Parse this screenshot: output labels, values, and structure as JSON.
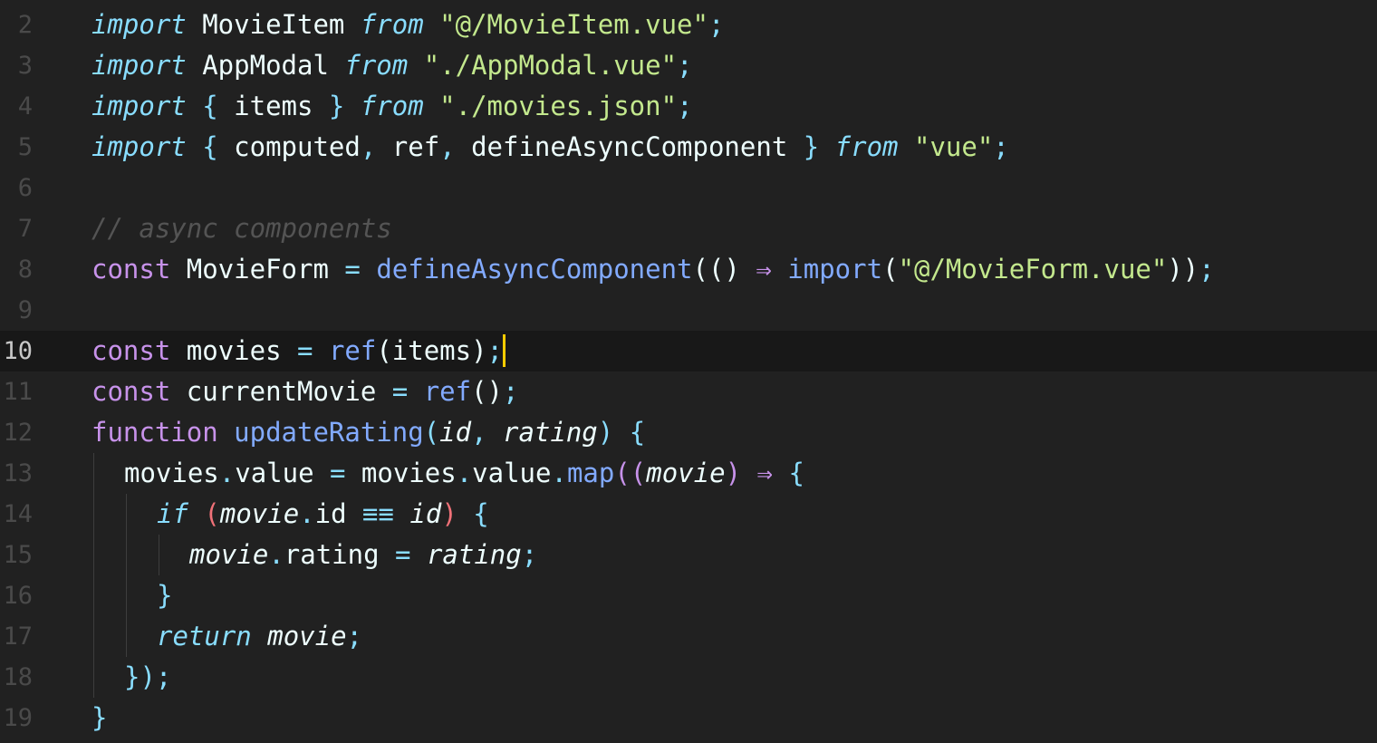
{
  "editor": {
    "cursor_line": 10,
    "colors": {
      "background": "#212121",
      "active_line": "#181818",
      "cursor": "#ffcc00",
      "keyword_italic": "#89ddff",
      "keyword": "#c792ea",
      "function": "#82aaff",
      "string": "#c3e88d",
      "comment": "#545454"
    },
    "lines": [
      {
        "n": "2",
        "tokens": [
          {
            "t": "import",
            "c": "kw-i"
          },
          {
            "t": " MovieItem ",
            "c": "id"
          },
          {
            "t": "from",
            "c": "kw-i"
          },
          {
            "t": " ",
            "c": "id"
          },
          {
            "t": "\"@/MovieItem.vue\"",
            "c": "str"
          },
          {
            "t": ";",
            "c": "pu"
          }
        ]
      },
      {
        "n": "3",
        "tokens": [
          {
            "t": "import",
            "c": "kw-i"
          },
          {
            "t": " AppModal ",
            "c": "id"
          },
          {
            "t": "from",
            "c": "kw-i"
          },
          {
            "t": " ",
            "c": "id"
          },
          {
            "t": "\"./AppModal.vue\"",
            "c": "str"
          },
          {
            "t": ";",
            "c": "pu"
          }
        ]
      },
      {
        "n": "4",
        "tokens": [
          {
            "t": "import",
            "c": "kw-i"
          },
          {
            "t": " ",
            "c": "id"
          },
          {
            "t": "{",
            "c": "br"
          },
          {
            "t": " items ",
            "c": "id"
          },
          {
            "t": "}",
            "c": "br"
          },
          {
            "t": " ",
            "c": "id"
          },
          {
            "t": "from",
            "c": "kw-i"
          },
          {
            "t": " ",
            "c": "id"
          },
          {
            "t": "\"./movies.json\"",
            "c": "str"
          },
          {
            "t": ";",
            "c": "pu"
          }
        ]
      },
      {
        "n": "5",
        "tokens": [
          {
            "t": "import",
            "c": "kw-i"
          },
          {
            "t": " ",
            "c": "id"
          },
          {
            "t": "{",
            "c": "br"
          },
          {
            "t": " computed",
            "c": "id"
          },
          {
            "t": ",",
            "c": "pu"
          },
          {
            "t": " ref",
            "c": "id"
          },
          {
            "t": ",",
            "c": "pu"
          },
          {
            "t": " defineAsyncComponent ",
            "c": "id"
          },
          {
            "t": "}",
            "c": "br"
          },
          {
            "t": " ",
            "c": "id"
          },
          {
            "t": "from",
            "c": "kw-i"
          },
          {
            "t": " ",
            "c": "id"
          },
          {
            "t": "\"vue\"",
            "c": "str"
          },
          {
            "t": ";",
            "c": "pu"
          }
        ]
      },
      {
        "n": "6",
        "tokens": []
      },
      {
        "n": "7",
        "tokens": [
          {
            "t": "// async components",
            "c": "cm"
          }
        ]
      },
      {
        "n": "8",
        "tokens": [
          {
            "t": "const",
            "c": "kw"
          },
          {
            "t": " MovieForm ",
            "c": "id"
          },
          {
            "t": "=",
            "c": "pu"
          },
          {
            "t": " ",
            "c": "id"
          },
          {
            "t": "defineAsyncComponent",
            "c": "fn"
          },
          {
            "t": "(() ",
            "c": "id"
          },
          {
            "t": "⇒",
            "c": "kw"
          },
          {
            "t": " ",
            "c": "id"
          },
          {
            "t": "import",
            "c": "fn"
          },
          {
            "t": "(",
            "c": "id"
          },
          {
            "t": "\"@/MovieForm.vue\"",
            "c": "str"
          },
          {
            "t": "))",
            "c": "id"
          },
          {
            "t": ";",
            "c": "pu"
          }
        ]
      },
      {
        "n": "9",
        "tokens": []
      },
      {
        "n": "10",
        "tokens": [
          {
            "t": "const",
            "c": "kw"
          },
          {
            "t": " movies ",
            "c": "id"
          },
          {
            "t": "=",
            "c": "pu"
          },
          {
            "t": " ",
            "c": "id"
          },
          {
            "t": "ref",
            "c": "fn"
          },
          {
            "t": "(items)",
            "c": "id"
          },
          {
            "t": ";",
            "c": "pu"
          }
        ]
      },
      {
        "n": "11",
        "tokens": [
          {
            "t": "const",
            "c": "kw"
          },
          {
            "t": " currentMovie ",
            "c": "id"
          },
          {
            "t": "=",
            "c": "pu"
          },
          {
            "t": " ",
            "c": "id"
          },
          {
            "t": "ref",
            "c": "fn"
          },
          {
            "t": "()",
            "c": "id"
          },
          {
            "t": ";",
            "c": "pu"
          }
        ]
      },
      {
        "n": "12",
        "tokens": [
          {
            "t": "function",
            "c": "kw"
          },
          {
            "t": " ",
            "c": "id"
          },
          {
            "t": "updateRating",
            "c": "fn"
          },
          {
            "t": "(",
            "c": "br"
          },
          {
            "t": "id",
            "c": "param"
          },
          {
            "t": ",",
            "c": "pu"
          },
          {
            "t": " ",
            "c": "id"
          },
          {
            "t": "rating",
            "c": "param"
          },
          {
            "t": ")",
            "c": "br"
          },
          {
            "t": " ",
            "c": "id"
          },
          {
            "t": "{",
            "c": "br"
          }
        ]
      },
      {
        "n": "13",
        "indent": 1,
        "tokens": [
          {
            "t": "movies",
            "c": "id"
          },
          {
            "t": ".",
            "c": "pu"
          },
          {
            "t": "value ",
            "c": "id"
          },
          {
            "t": "=",
            "c": "pu"
          },
          {
            "t": " movies",
            "c": "id"
          },
          {
            "t": ".",
            "c": "pu"
          },
          {
            "t": "value",
            "c": "id"
          },
          {
            "t": ".",
            "c": "pu"
          },
          {
            "t": "map",
            "c": "fn"
          },
          {
            "t": "((",
            "c": "kw"
          },
          {
            "t": "movie",
            "c": "param"
          },
          {
            "t": ")",
            "c": "kw"
          },
          {
            "t": " ",
            "c": "id"
          },
          {
            "t": "⇒",
            "c": "kw"
          },
          {
            "t": " ",
            "c": "id"
          },
          {
            "t": "{",
            "c": "br"
          }
        ]
      },
      {
        "n": "14",
        "indent": 2,
        "tokens": [
          {
            "t": "if",
            "c": "kw-i"
          },
          {
            "t": " ",
            "c": "id"
          },
          {
            "t": "(",
            "c": "br2"
          },
          {
            "t": "movie",
            "c": "param"
          },
          {
            "t": ".",
            "c": "pu"
          },
          {
            "t": "id ",
            "c": "id"
          },
          {
            "t": "≡≡",
            "c": "br"
          },
          {
            "t": " ",
            "c": "id"
          },
          {
            "t": "id",
            "c": "param"
          },
          {
            "t": ")",
            "c": "br2"
          },
          {
            "t": " ",
            "c": "id"
          },
          {
            "t": "{",
            "c": "br"
          }
        ]
      },
      {
        "n": "15",
        "indent": 3,
        "tokens": [
          {
            "t": "movie",
            "c": "param"
          },
          {
            "t": ".",
            "c": "pu"
          },
          {
            "t": "rating ",
            "c": "id"
          },
          {
            "t": "=",
            "c": "pu"
          },
          {
            "t": " ",
            "c": "id"
          },
          {
            "t": "rating",
            "c": "param"
          },
          {
            "t": ";",
            "c": "pu"
          }
        ]
      },
      {
        "n": "16",
        "indent": 2,
        "tokens": [
          {
            "t": "}",
            "c": "br"
          }
        ]
      },
      {
        "n": "17",
        "indent": 2,
        "tokens": [
          {
            "t": "return",
            "c": "kw-i"
          },
          {
            "t": " ",
            "c": "id"
          },
          {
            "t": "movie",
            "c": "param"
          },
          {
            "t": ";",
            "c": "pu"
          }
        ]
      },
      {
        "n": "18",
        "indent": 1,
        "tokens": [
          {
            "t": "})",
            "c": "br"
          },
          {
            "t": ";",
            "c": "pu"
          }
        ]
      },
      {
        "n": "19",
        "tokens": [
          {
            "t": "}",
            "c": "br"
          }
        ]
      }
    ]
  }
}
